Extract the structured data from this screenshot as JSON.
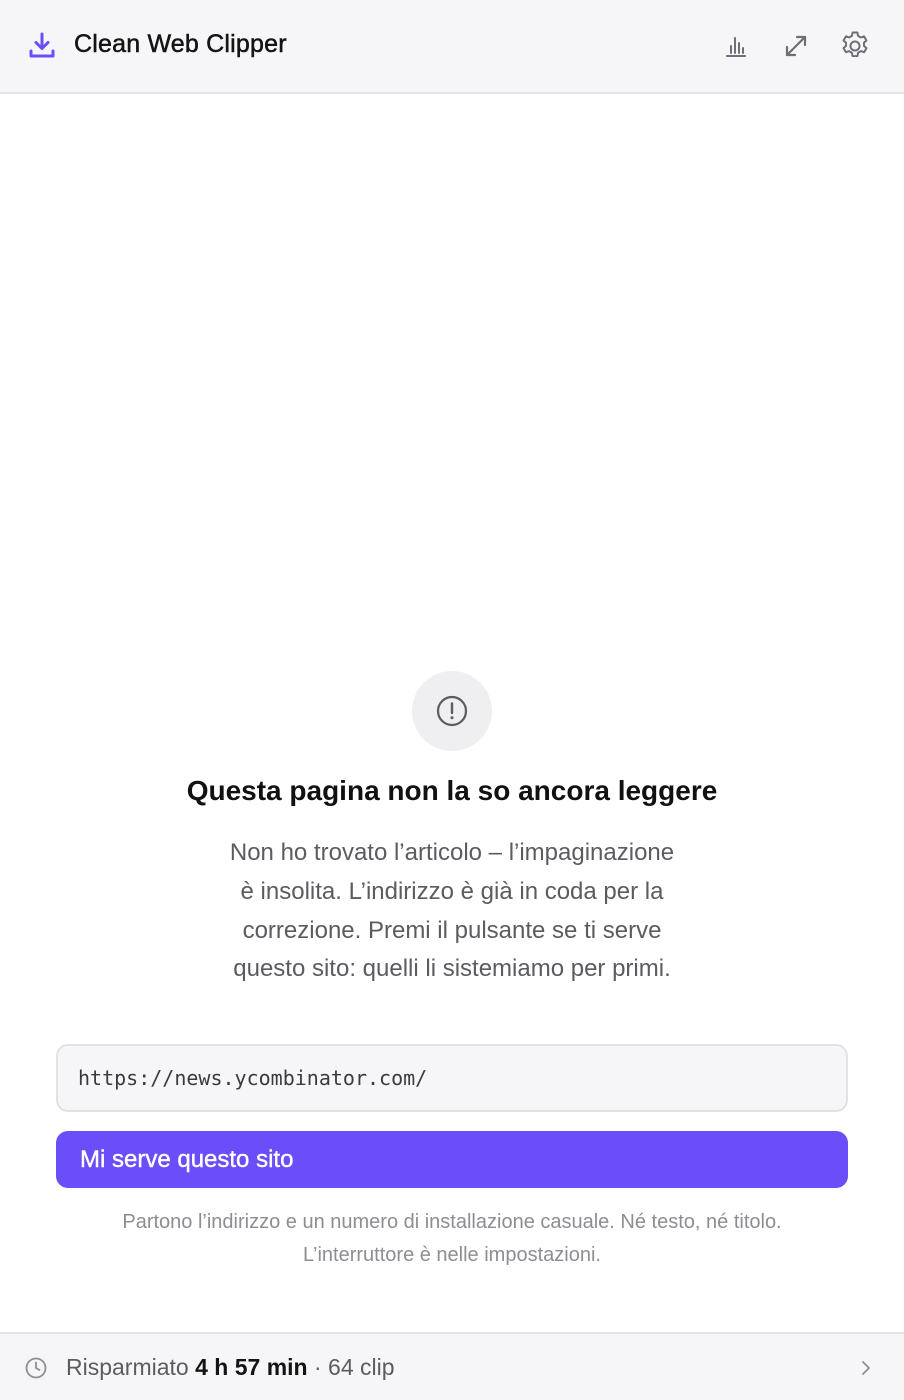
{
  "header": {
    "title": "Clean Web Clipper",
    "brand_icon": "download-tray-icon",
    "actions": [
      {
        "name": "stats",
        "icon": "bar-chart-icon"
      },
      {
        "name": "expand",
        "icon": "expand-arrows-icon"
      },
      {
        "name": "settings",
        "icon": "gear-icon"
      }
    ]
  },
  "error": {
    "icon": "alert-circle-icon",
    "title": "Questa pagina non la so ancora leggere",
    "body": "Non ho trovato l’articolo – l’impaginazione è insolita. L’indirizzo è già in coda per la correzione. Premi il pulsante se ti serve questo sito: quelli li sistemiamo per primi.",
    "url": "https://news.ycombinator.com/",
    "button_label": "Mi serve questo sito",
    "note_line1": "Partono l’indirizzo e un numero di installazione casuale. Né testo, né titolo.",
    "note_line2": "L’interruttore è nelle impostazioni."
  },
  "footer": {
    "prefix": "Risparmiato ",
    "time_saved": "4 h 57 min",
    "clips": " · 64 clip",
    "icon": "clock-icon",
    "chevron": "chevron-right-icon"
  },
  "colors": {
    "accent": "#6b4dfa",
    "header_bg": "#f6f6f8",
    "muted_text": "#5b5b62",
    "icon_gray": "#6e6e78"
  }
}
